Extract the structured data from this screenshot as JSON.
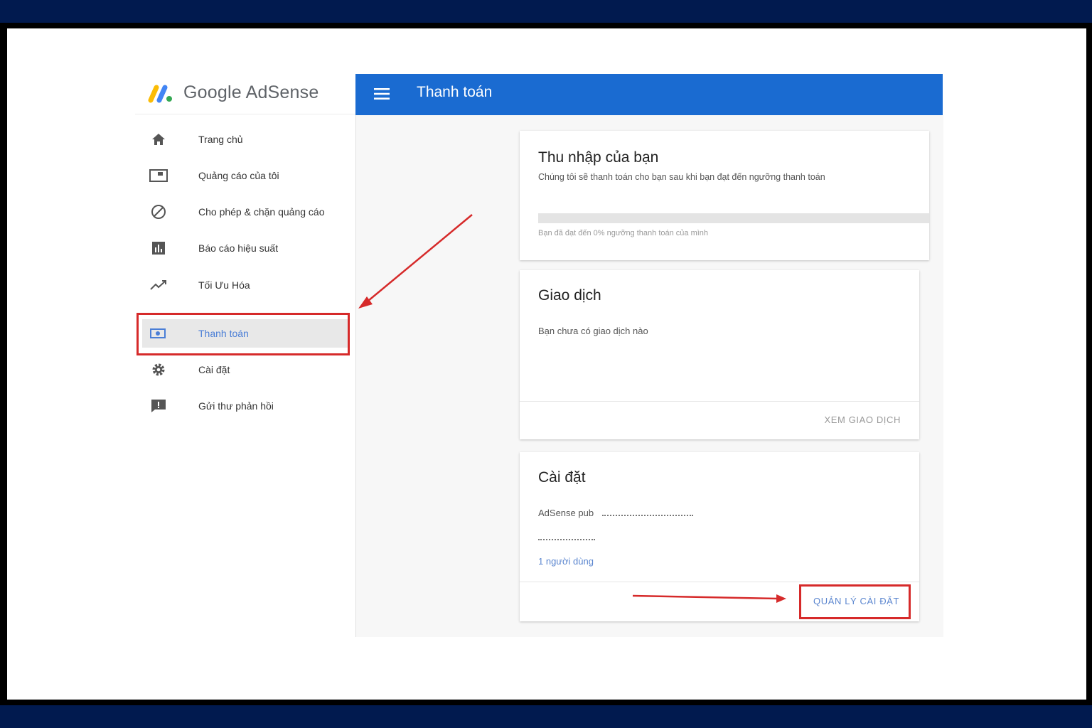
{
  "app": {
    "logo_text": "Google AdSense"
  },
  "sidebar": {
    "items": [
      {
        "label": "Trang chủ",
        "icon": "home-icon"
      },
      {
        "label": "Quảng cáo của tôi",
        "icon": "ad-unit-icon"
      },
      {
        "label": "Cho phép & chặn quảng cáo",
        "icon": "block-icon"
      },
      {
        "label": "Báo cáo hiệu suất",
        "icon": "bar-chart-icon"
      },
      {
        "label": "Tối Ưu Hóa",
        "icon": "trending-up-icon"
      },
      {
        "label": "Thanh toán",
        "icon": "payment-icon",
        "active": true
      },
      {
        "label": "Cài đặt",
        "icon": "gear-icon"
      },
      {
        "label": "Gửi thư phản hồi",
        "icon": "feedback-icon"
      }
    ]
  },
  "header": {
    "title": "Thanh toán",
    "menu_icon": "hamburger-menu-icon"
  },
  "earnings_card": {
    "title": "Thu nhập của bạn",
    "subtitle": "Chúng tôi sẽ thanh toán cho bạn sau khi bạn đạt đến ngưỡng thanh toán",
    "progress_percent": 0,
    "progress_note": "Bạn đã đạt đến 0% ngưỡng thanh toán của mình"
  },
  "transactions_card": {
    "title": "Giao dịch",
    "empty_text": "Bạn chưa có giao dịch nào",
    "action_label": "XEM GIAO DỊCH"
  },
  "settings_card": {
    "title": "Cài đặt",
    "publisher_label": "AdSense pub",
    "users_link": "1 người dùng",
    "action_label": "QUẢN LÝ CÀI ĐẶT"
  },
  "colors": {
    "header_blue": "#1a6bd1",
    "annotation_red": "#d62a2a",
    "outer_background": "#011a4f"
  }
}
